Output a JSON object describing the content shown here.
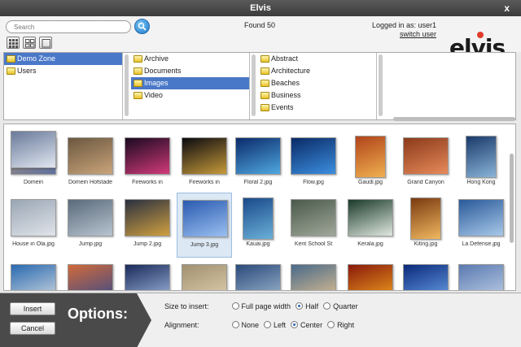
{
  "window": {
    "title": "Elvis",
    "close_glyph": "x"
  },
  "search": {
    "placeholder": "Search"
  },
  "toolbar": {
    "found_text": "Found 50",
    "logged_in_text": "Logged in as: user1",
    "switch_user_label": "switch user",
    "logo_text": "elvis"
  },
  "folders": {
    "col1": [
      {
        "label": "Demo Zone",
        "selected": true
      },
      {
        "label": "Users",
        "selected": false
      }
    ],
    "col2": [
      {
        "label": "Archive",
        "selected": false
      },
      {
        "label": "Documents",
        "selected": false
      },
      {
        "label": "Images",
        "selected": true
      },
      {
        "label": "Video",
        "selected": false
      }
    ],
    "col3": [
      {
        "label": "Abstract",
        "selected": false
      },
      {
        "label": "Architecture",
        "selected": false
      },
      {
        "label": "Beaches",
        "selected": false
      },
      {
        "label": "Business",
        "selected": false
      },
      {
        "label": "Events",
        "selected": false
      }
    ]
  },
  "thumbnails": [
    {
      "caption": "Domein",
      "colors": [
        "#c9a06a",
        "#5b6fa0"
      ]
    },
    {
      "caption": "Domein Hofstade",
      "colors": [
        "#6b5840",
        "#c9a47a"
      ]
    },
    {
      "caption": "Fireworks in",
      "colors": [
        "#1a0a20",
        "#d23a7a"
      ]
    },
    {
      "caption": "Fireworks in",
      "colors": [
        "#0b0b10",
        "#c79a3a"
      ]
    },
    {
      "caption": "Floral 2.jpg",
      "colors": [
        "#0b2a6a",
        "#4fa8e0"
      ]
    },
    {
      "caption": "Flow.jpg",
      "colors": [
        "#0a2a66",
        "#3c8fe0"
      ]
    },
    {
      "caption": "Gaudi.jpg",
      "colors": [
        "#b0441a",
        "#f0b050"
      ]
    },
    {
      "caption": "Grand Canyon",
      "colors": [
        "#8a3a1a",
        "#e88a5a"
      ]
    },
    {
      "caption": "Hong Kong",
      "colors": [
        "#1a3a6a",
        "#8ab4d8"
      ]
    },
    {
      "caption": "House in Ola.jpg",
      "colors": [
        "#9aa6b4",
        "#e0e4ea"
      ]
    },
    {
      "caption": "Jump.jpg",
      "colors": [
        "#5a6a7a",
        "#b8c4d0"
      ]
    },
    {
      "caption": "Jump 2.jpg",
      "colors": [
        "#2a3040",
        "#d0a040"
      ]
    },
    {
      "caption": "Jump 3.jpg",
      "colors": [
        "#2a5ab0",
        "#9ac0f0"
      ]
    },
    {
      "caption": "Kauai.jpg",
      "colors": [
        "#1a4a8a",
        "#6ab0d8"
      ]
    },
    {
      "caption": "Kent School St",
      "colors": [
        "#4a5a4a",
        "#a0a89a"
      ]
    },
    {
      "caption": "Kerala.jpg",
      "colors": [
        "#1a3a2a",
        "#e0e8e0"
      ]
    },
    {
      "caption": "Kiting.jpg",
      "colors": [
        "#7a3a10",
        "#f0b860"
      ]
    },
    {
      "caption": "La Defense.jpg",
      "colors": [
        "#2a5a9a",
        "#a8c8e8"
      ]
    },
    {
      "caption": "",
      "colors": [
        "#2a6ab0",
        "#d0d8e0"
      ]
    },
    {
      "caption": "",
      "colors": [
        "#d06a3a",
        "#3a4a8a"
      ]
    },
    {
      "caption": "",
      "colors": [
        "#1a2a5a",
        "#a0b8e0"
      ]
    },
    {
      "caption": "",
      "colors": [
        "#a09070",
        "#e0d0b0"
      ]
    },
    {
      "caption": "",
      "colors": [
        "#2a4a7a",
        "#a0b8d0"
      ]
    },
    {
      "caption": "",
      "colors": [
        "#4a6a8a",
        "#e0c090"
      ]
    },
    {
      "caption": "",
      "colors": [
        "#8a1a0a",
        "#f0a020"
      ]
    },
    {
      "caption": "",
      "colors": [
        "#0a2a7a",
        "#6aa0e8"
      ]
    },
    {
      "caption": "",
      "colors": [
        "#5a7ab0",
        "#c0d0e8"
      ]
    },
    {
      "caption": "",
      "colors": [
        "#6a7a9a",
        "#e0e6f0"
      ]
    }
  ],
  "actions": {
    "insert_label": "Insert",
    "cancel_label": "Cancel",
    "options_label": "Options:"
  },
  "options": {
    "size_label": "Size to insert:",
    "sizes": [
      {
        "label": "Full page width",
        "checked": false
      },
      {
        "label": "Half",
        "checked": true
      },
      {
        "label": "Quarter",
        "checked": false
      }
    ],
    "align_label": "Alignment:",
    "alignments": [
      {
        "label": "None",
        "checked": false
      },
      {
        "label": "Left",
        "checked": false
      },
      {
        "label": "Center",
        "checked": true
      },
      {
        "label": "Right",
        "checked": false
      }
    ]
  }
}
